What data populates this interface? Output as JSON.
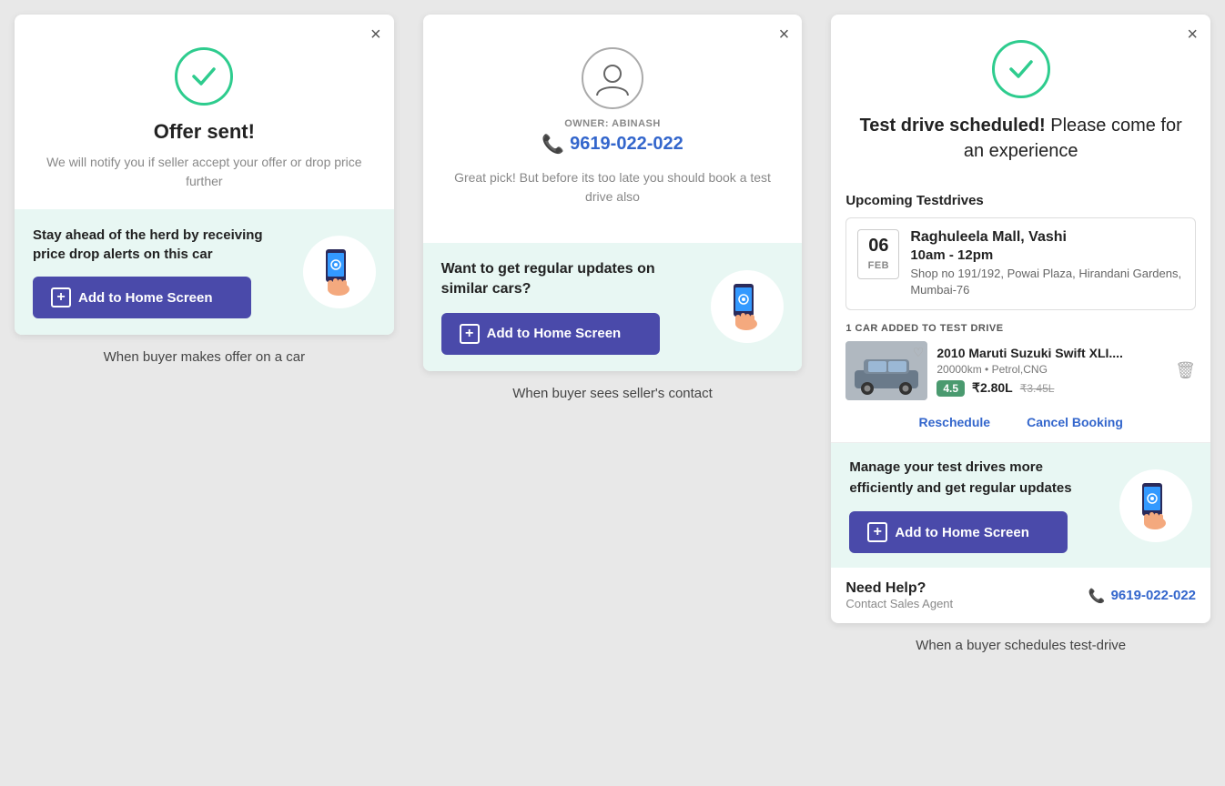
{
  "panel1": {
    "close": "×",
    "title": "Offer sent!",
    "subtitle": "We will notify you if seller accept your offer or drop price further",
    "alert_text": "Stay ahead of the herd by receiving price drop alerts on this car",
    "add_btn": "Add to Home Screen",
    "caption": "When buyer makes offer on a car"
  },
  "panel2": {
    "close": "×",
    "owner_label": "OWNER: ABINASH",
    "owner_phone": "9619-022-022",
    "desc": "Great pick! But before its too late you should book a test drive also",
    "banner_title": "Want to get regular updates on similar cars?",
    "add_btn": "Add to Home Screen",
    "caption": "When buyer sees seller's contact"
  },
  "panel3": {
    "close": "×",
    "title_bold": "Test drive scheduled!",
    "title_rest": " Please come for an experience",
    "upcoming_label": "Upcoming Testdrives",
    "date_num": "06",
    "date_month": "FEB",
    "venue_name": "Raghuleela Mall, Vashi",
    "time": "10am - 12pm",
    "address": "Shop no 191/192, Powai Plaza, Hirandani Gardens, Mumbai-76",
    "car_added_label": "1 CAR ADDED TO TEST DRIVE",
    "car_name": "2010 Maruti Suzuki Swift XLI....",
    "car_km": "20000km • Petrol,CNG",
    "car_rating": "4.5",
    "car_price": "₹2.80L",
    "car_price_old": "₹3.45L",
    "reschedule": "Reschedule",
    "cancel_booking": "Cancel Booking",
    "banner_title": "Manage your test drives more efficiently and get regular updates",
    "add_btn": "Add to Home Screen",
    "help_title": "Need Help?",
    "help_sub": "Contact Sales Agent",
    "help_phone": "9619-022-022",
    "caption": "When a buyer schedules test-drive"
  }
}
